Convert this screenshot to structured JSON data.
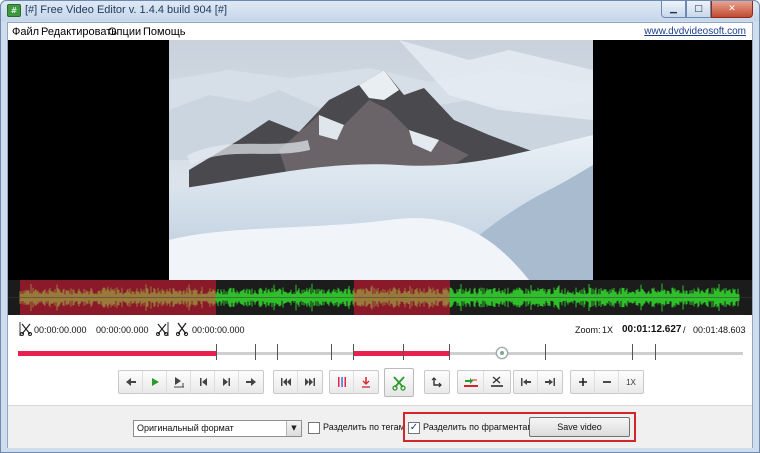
{
  "window": {
    "title": "[#] Free Video Editor v. 1.4.4 build 904 [#]",
    "icon_text": "#",
    "min_glyph": "▁",
    "max_glyph": "□",
    "close_glyph": "✕"
  },
  "menu": {
    "items": [
      "Файл",
      "Редактировать",
      "Опции",
      "Помощь"
    ],
    "site_link": "www.dvdvideosoft.com"
  },
  "time_row": {
    "start_time": "00:00:00.000",
    "end_time": "00:00:00.000",
    "cut_time": "00:00:00.000",
    "zoom_label": "Zoom:",
    "zoom_value": "1X",
    "current_time": "00:01:12.627",
    "separator": "/",
    "total_time": "00:01:48.603"
  },
  "timeline": {
    "position_fraction": 0.667
  },
  "toolbar": {
    "zoom_reset_label": "1X",
    "icons": [
      "prev-frame-icon",
      "play-icon",
      "play-selection-icon",
      "go-start-icon",
      "go-end-icon",
      "next-frame-icon",
      "prev-marker-icon",
      "next-marker-icon",
      "split-marker-icon",
      "delete-marker-icon",
      "cut-icon",
      "rotate-icon",
      "add-fragment-icon",
      "remove-fragment-icon",
      "jump-start-icon",
      "jump-end-icon",
      "zoom-in-icon",
      "zoom-out-icon",
      "zoom-reset-icon"
    ]
  },
  "bottom": {
    "format_value": "Оригинальный формат",
    "split_by_tags_label": "Разделить по тегам",
    "split_by_tags_checked": false,
    "split_by_fragments_label": "Разделить по фрагментам",
    "split_by_fragments_checked": true,
    "check_glyph": "✓",
    "save_label": "Save video"
  },
  "colors": {
    "accent_red": "#e8204d",
    "highlight_red": "#d2262b",
    "waveform_selected_bg": "#8a1a2a",
    "waveform_green": "#2fbf2a",
    "waveform_olive": "#9a7a3a",
    "link_blue": "#1a3f8a"
  }
}
